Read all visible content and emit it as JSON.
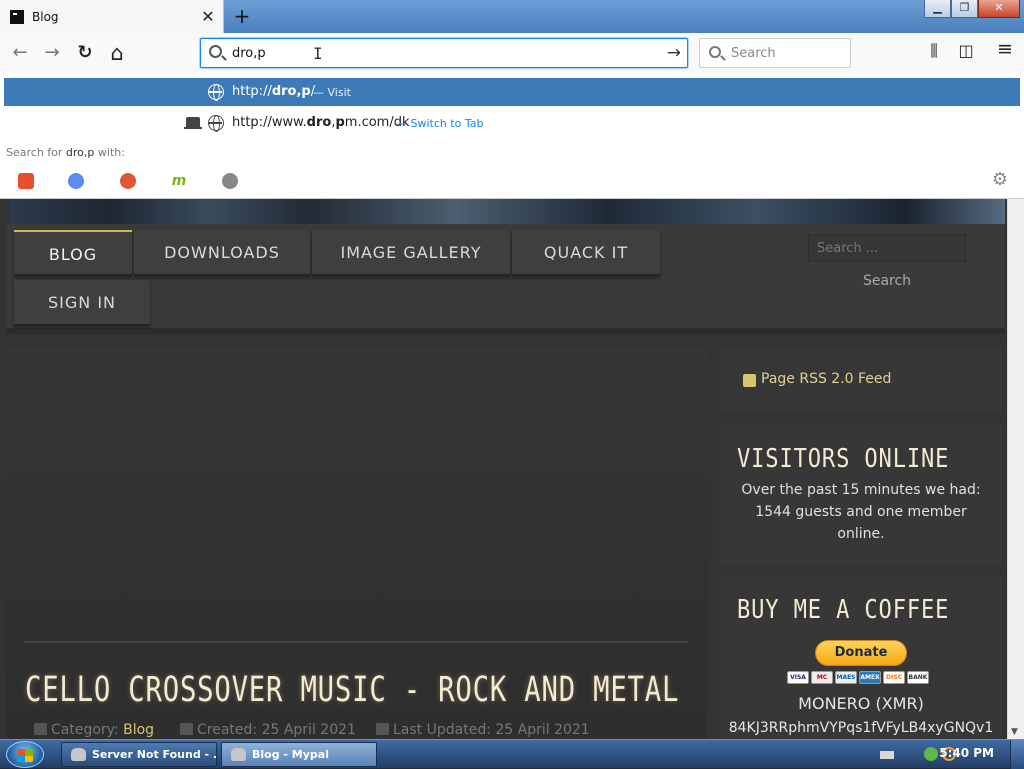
{
  "browser": {
    "tab": {
      "title": "Blog",
      "close": "✕"
    },
    "new_tab": "+",
    "window_controls": {
      "minimize": "▁",
      "maximize": "❐",
      "close": "✕"
    },
    "nav": {
      "back": "←",
      "forward": "→",
      "reload": "↻",
      "home": "⌂"
    },
    "urlbar": {
      "value": "dro,p",
      "go": "→"
    },
    "search": {
      "placeholder": "Search"
    },
    "toolbar_right": {
      "library": "⫼",
      "sidebar": "◫",
      "menu": "≡"
    }
  },
  "dropdown": {
    "suggestion_1": {
      "prefix": "http://",
      "bold": "dro,p",
      "suffix": "/",
      "action": "— Visit"
    },
    "suggestion_2": {
      "prefix": "http://www.",
      "bold1": "dro",
      "mid": ",",
      "bold2": "p",
      "suffix": "m.com/dk",
      "action": "— Switch to Tab"
    },
    "search_for": {
      "label": "Search for",
      "query": "dro,p",
      "tail": "with:"
    },
    "engines": [
      {
        "name": "brave",
        "color": "#e8502d"
      },
      {
        "name": "qwant",
        "color": "#5b8cf0"
      },
      {
        "name": "duckduckgo",
        "color": "#de5833"
      },
      {
        "name": "mojeek",
        "color": "#7ab317"
      },
      {
        "name": "other",
        "color": "#888888"
      }
    ],
    "settings": "⚙"
  },
  "site": {
    "menu": [
      "BLOG",
      "DOWNLOADS",
      "IMAGE GALLERY",
      "QUACK IT",
      "SIGN IN"
    ],
    "search": {
      "placeholder": "Search ...",
      "button": "Search"
    },
    "article": {
      "title": "CELLO CROSSOVER MUSIC - ROCK AND METAL",
      "category_label": "Category:",
      "category": "Blog",
      "created": "Created: 25 April 2021",
      "updated": "Last Updated: 25 April 2021"
    },
    "sidebar": {
      "rss": "Page RSS 2.0 Feed",
      "visitors_title": "VISITORS ONLINE",
      "visitors_text": "Over the past 15 minutes we had: 1544 guests and one member online.",
      "coffee_title": "BUY ME A COFFEE",
      "donate": "Donate",
      "cards": [
        "VISA",
        "MC",
        "MAES",
        "AMEX",
        "DISC",
        "BANK"
      ],
      "monero": "MONERO (XMR)",
      "address": "84KJ3RRphmVYPqs1fVFyLB4xyGNQv1"
    }
  },
  "taskbar": {
    "tasks": [
      "Server Not Found - ...",
      "Blog - Mypal"
    ],
    "clock": "5:40 PM"
  }
}
